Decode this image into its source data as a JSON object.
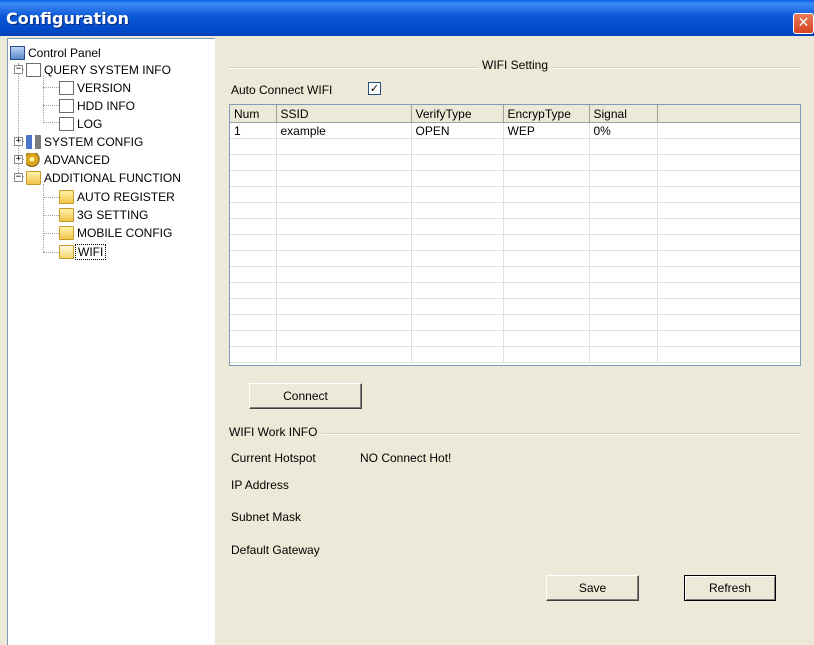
{
  "window": {
    "title": "Configuration",
    "close_glyph": "✕"
  },
  "tree": {
    "root": "Control Panel",
    "query": "QUERY SYSTEM INFO",
    "version": "VERSION",
    "hdd": "HDD INFO",
    "log": "LOG",
    "system_config": "SYSTEM CONFIG",
    "advanced": "ADVANCED",
    "additional": "ADDITIONAL FUNCTION",
    "auto_register": "AUTO REGISTER",
    "g3_setting": "3G SETTING",
    "mobile_config": "MOBILE CONFIG",
    "wifi": "WIFI"
  },
  "wifi_setting": {
    "group_title": "WIFI Setting",
    "auto_connect_label": "Auto Connect WIFI",
    "auto_connect_checked": true,
    "checkmark": "✓",
    "columns": [
      "Num",
      "SSID",
      "VerifyType",
      "EncrypType",
      "Signal"
    ],
    "rows": [
      [
        "1",
        "example",
        "OPEN",
        "WEP",
        "0%"
      ]
    ],
    "connect_button": "Connect"
  },
  "work_info": {
    "group_title": "WIFI Work INFO",
    "current_hotspot_label": "Current Hotspot",
    "current_hotspot_value": "NO Connect Hot!",
    "ip_label": "IP Address",
    "subnet_label": "Subnet Mask",
    "gateway_label": "Default Gateway"
  },
  "footer": {
    "save": "Save",
    "refresh": "Refresh"
  },
  "icons": {
    "collapse": "−",
    "expand": "+"
  }
}
